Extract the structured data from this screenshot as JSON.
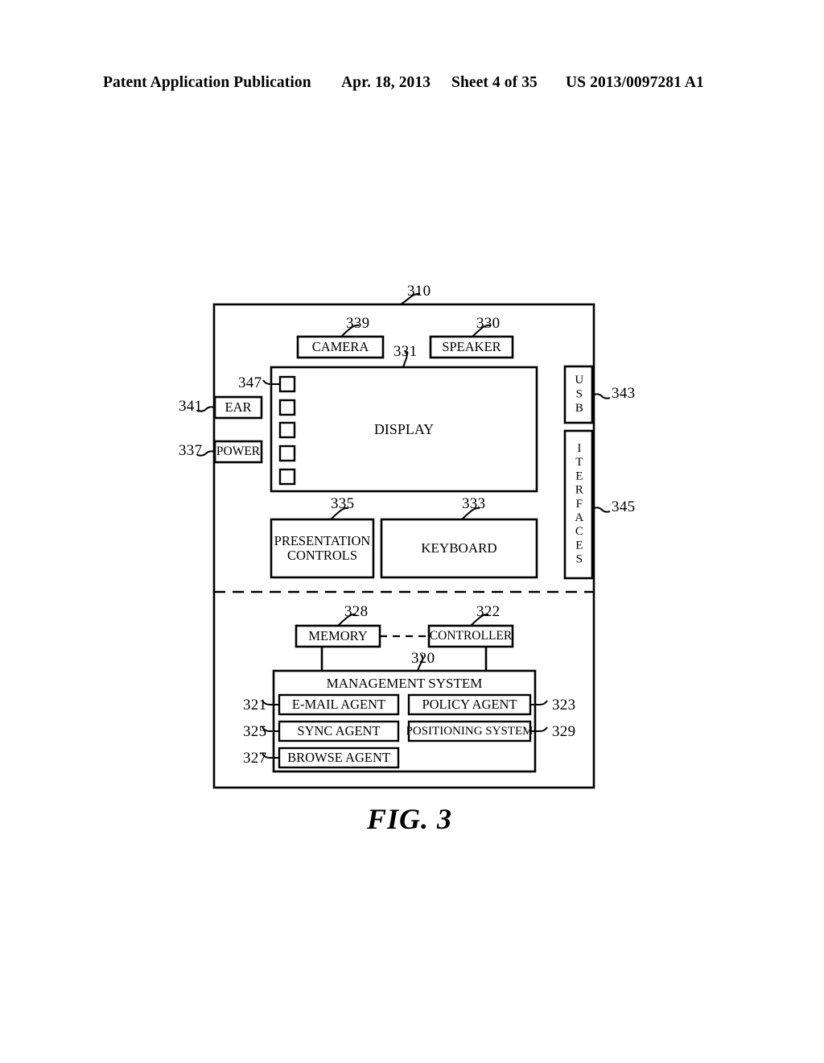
{
  "header": {
    "publication": "Patent Application Publication",
    "date": "Apr. 18, 2013",
    "sheet": "Sheet 4 of 35",
    "patent_number": "US 2013/0097281 A1"
  },
  "figure": {
    "caption": "FIG. 3",
    "device_ref": "310",
    "blocks": {
      "camera": {
        "label": "CAMERA",
        "ref": "339"
      },
      "speaker": {
        "label": "SPEAKER",
        "ref": "330"
      },
      "display": {
        "label": "DISPLAY",
        "ref": "331"
      },
      "soft_keys": {
        "ref": "347",
        "count": 5
      },
      "ear": {
        "label": "EAR",
        "ref": "341"
      },
      "power": {
        "label": "POWER",
        "ref": "337"
      },
      "usb": {
        "label": "USB",
        "ref": "343"
      },
      "interfaces": {
        "label": "ITERFACES",
        "ref": "345"
      },
      "presentation_controls": {
        "label": "PRESENTATION CONTROLS",
        "line1": "PRESENTATION",
        "line2": "CONTROLS",
        "ref": "335"
      },
      "keyboard": {
        "label": "KEYBOARD",
        "ref": "333"
      },
      "memory": {
        "label": "MEMORY",
        "ref": "328"
      },
      "controller": {
        "label": "CONTROLLER",
        "ref": "322"
      },
      "management_system": {
        "label": "MANAGEMENT SYSTEM",
        "ref": "320"
      },
      "email_agent": {
        "label": "E-MAIL AGENT",
        "ref": "321"
      },
      "policy_agent": {
        "label": "POLICY AGENT",
        "ref": "323"
      },
      "sync_agent": {
        "label": "SYNC AGENT",
        "ref": "325"
      },
      "positioning_system": {
        "label": "POSITIONING SYSTEM",
        "ref": "329"
      },
      "browse_agent": {
        "label": "BROWSE AGENT",
        "ref": "327"
      }
    }
  }
}
